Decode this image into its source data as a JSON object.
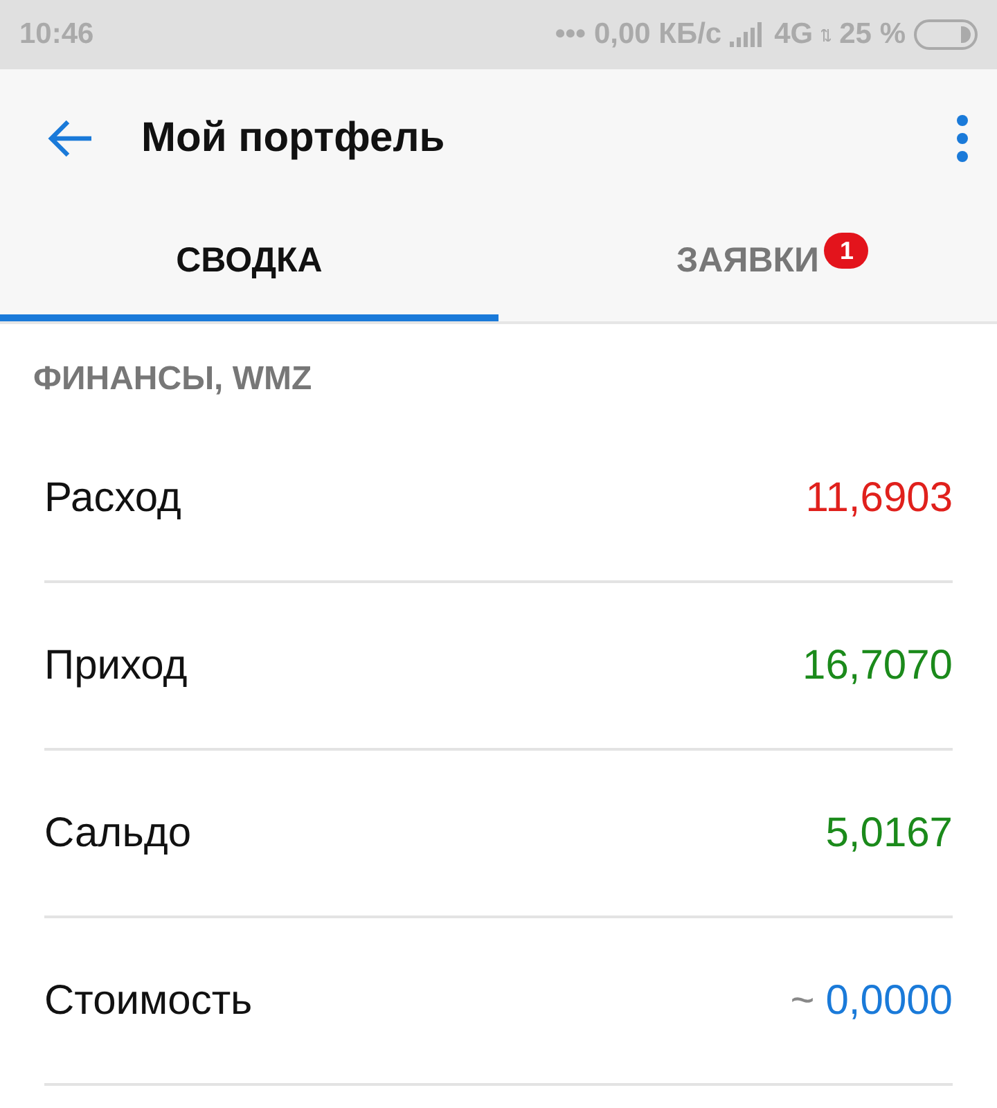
{
  "status_bar": {
    "time": "10:46",
    "dots": "•••",
    "speed": "0,00 КБ/с",
    "network": "4G",
    "battery": "25 %"
  },
  "toolbar": {
    "title": "Мой портфель"
  },
  "tabs": [
    {
      "label": "СВОДКА",
      "selected": true
    },
    {
      "label": "ЗАЯВКИ",
      "selected": false,
      "badge": "1"
    }
  ],
  "section": {
    "title": "ФИНАНСЫ, WMZ"
  },
  "rows": [
    {
      "label": "Расход",
      "value": "11,6903",
      "color": "#e0201c"
    },
    {
      "label": "Приход",
      "value": "16,7070",
      "color": "#1b8a1b"
    },
    {
      "label": "Сальдо",
      "value": "5,0167",
      "color": "#1b8a1b"
    },
    {
      "label": "Стоимость",
      "prefix": "~",
      "value": "0,0000",
      "color": "#1a7ad9"
    }
  ]
}
